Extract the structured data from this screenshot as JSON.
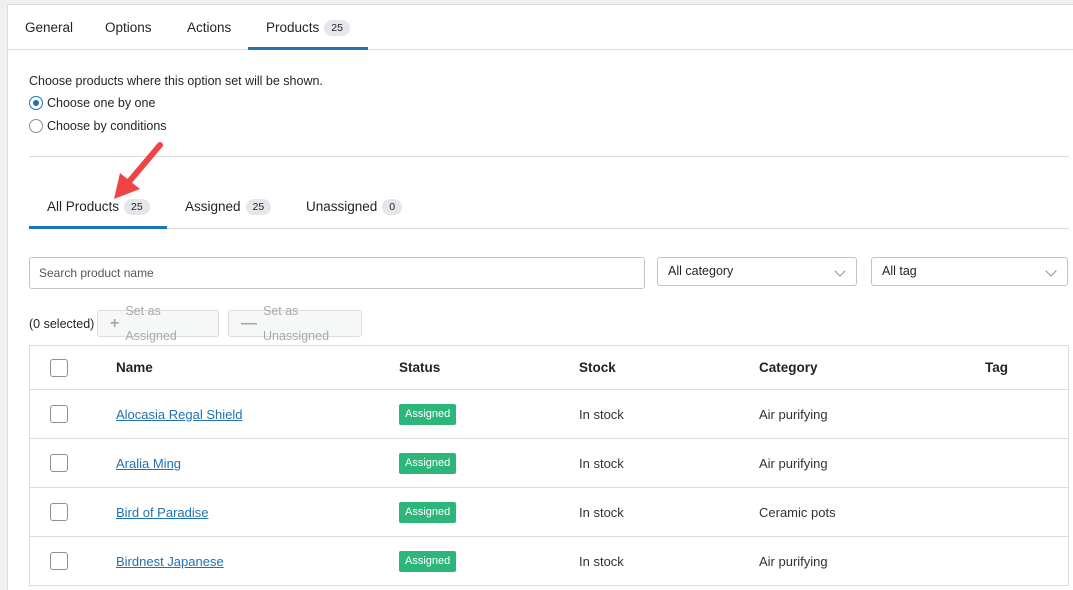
{
  "top_tabs": [
    {
      "label": "General"
    },
    {
      "label": "Options"
    },
    {
      "label": "Actions"
    },
    {
      "label": "Products",
      "badge": "25"
    }
  ],
  "intro": "Choose products where this option set will be shown.",
  "radios": [
    {
      "label": "Choose one by one",
      "checked": true
    },
    {
      "label": "Choose by conditions",
      "checked": false
    }
  ],
  "sub_tabs": [
    {
      "label": "All Products",
      "badge": "25"
    },
    {
      "label": "Assigned",
      "badge": "25"
    },
    {
      "label": "Unassigned",
      "badge": "0"
    }
  ],
  "search": {
    "placeholder": "Search product name"
  },
  "filters": {
    "category": "All category",
    "tag": "All tag"
  },
  "bulk": {
    "selected": "(0 selected)",
    "set_assigned": "Set as Assigned",
    "set_unassigned": "Set as Unassigned"
  },
  "table": {
    "headers": {
      "name": "Name",
      "status": "Status",
      "stock": "Stock",
      "category": "Category",
      "tag": "Tag"
    },
    "rows": [
      {
        "name": "Alocasia Regal Shield",
        "status": "Assigned",
        "stock": "In stock",
        "category": "Air purifying",
        "tag": ""
      },
      {
        "name": "Aralia Ming",
        "status": "Assigned",
        "stock": "In stock",
        "category": "Air purifying",
        "tag": ""
      },
      {
        "name": "Bird of Paradise",
        "status": "Assigned",
        "stock": "In stock",
        "category": "Ceramic pots",
        "tag": ""
      },
      {
        "name": "Birdnest Japanese",
        "status": "Assigned",
        "stock": "In stock",
        "category": "Air purifying",
        "tag": ""
      }
    ]
  },
  "colors": {
    "accent": "#1c77b3",
    "link": "#2271b1",
    "status_assigned": "#2db67c",
    "annotation_arrow": "#ef4444"
  }
}
